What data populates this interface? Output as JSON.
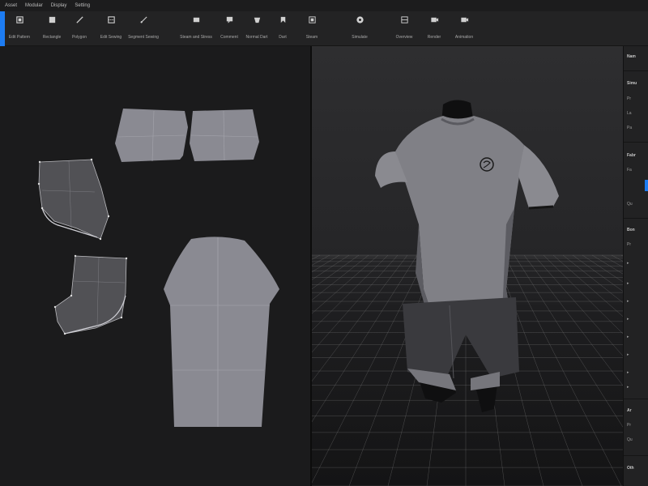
{
  "menu": [
    "Asset",
    "Modular",
    "Display",
    "Setting"
  ],
  "toolbar": {
    "tools": [
      {
        "label": "Edit Pattern",
        "icon": "select-icon"
      },
      {
        "label": "Rectangle",
        "icon": "rectangle-icon"
      },
      {
        "label": "Polygon",
        "icon": "polygon-icon"
      },
      {
        "label": "Edit Sewing",
        "icon": "edit-sewing-icon"
      },
      {
        "label": "Segment Sewing",
        "icon": "segment-sewing-icon"
      },
      {
        "label": "Steam and Stress",
        "icon": "steam-icon"
      },
      {
        "label": "Comment",
        "icon": "comment-icon"
      },
      {
        "label": "Normal Dart",
        "icon": "normal-dart-icon"
      },
      {
        "label": "Dart",
        "icon": "dart-icon"
      },
      {
        "label": "Steam",
        "icon": "steam-pattern-icon"
      },
      {
        "label": "Simulate",
        "icon": "simulate-icon"
      },
      {
        "label": "Overview",
        "icon": "overview-icon"
      },
      {
        "label": "Render",
        "icon": "render-icon"
      },
      {
        "label": "Animation",
        "icon": "animation-icon"
      }
    ]
  },
  "colors": {
    "accent": "#1d7cf2",
    "pattern_fill": "#8a8a92",
    "shorts_pattern_fill": "#515155",
    "grid_line": "#7a7a7a"
  },
  "right_panel": {
    "rows": [
      {
        "text": "Nam",
        "kind": "head"
      },
      {
        "text": "Simu",
        "kind": "head"
      },
      {
        "text": "Pr",
        "kind": "item"
      },
      {
        "text": "La",
        "kind": "item"
      },
      {
        "text": "Pa",
        "kind": "item"
      },
      {
        "text": "Fabr",
        "kind": "head"
      },
      {
        "text": "Fa",
        "kind": "item"
      },
      {
        "text": "Qu",
        "kind": "item"
      },
      {
        "text": "Bon",
        "kind": "head"
      },
      {
        "text": "Pr",
        "kind": "item"
      },
      {
        "text": "Ar",
        "kind": "head"
      },
      {
        "text": "Pr",
        "kind": "item"
      },
      {
        "text": "Qu",
        "kind": "item"
      },
      {
        "text": "Oth",
        "kind": "head"
      }
    ]
  }
}
